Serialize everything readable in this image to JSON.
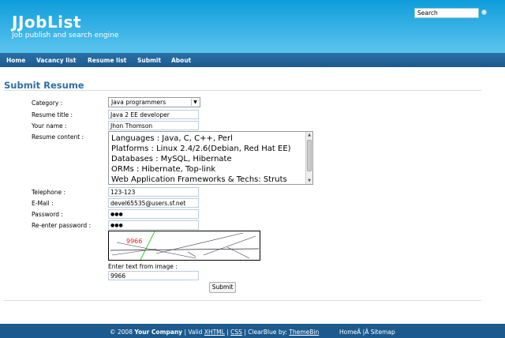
{
  "header": {
    "title": "JJobList",
    "subtitle": "Job publish and search engine",
    "search_value": "Search"
  },
  "nav": [
    "Home",
    "Vacancy list",
    "Resume list",
    "Submit",
    "About"
  ],
  "page_title": "Submit Resume",
  "form": {
    "category_label": "Category :",
    "category_value": "Java programmers",
    "resume_title_label": "Resume title :",
    "resume_title_value": "Java 2 EE developer",
    "name_label": "Your name :",
    "name_value": "Jhon Thomson",
    "content_label": "Resume content :",
    "content_lines": [
      "Languages : Java, C, C++, Perl",
      "Platforms : Linux 2.4/2.6(Debian, Red Hat EE)",
      "Databases : MySQL, Hibernate",
      "ORMs : Hibernate, Top-link",
      "Web Application Frameworks & Techs: Struts"
    ],
    "telephone_label": "Telephone :",
    "telephone_value": "123-123",
    "email_label": "E-Mail :",
    "email_value": "devel65535@users.sf.net",
    "password_label": "Password :",
    "password_value": "●●●",
    "repassword_label": "Re-enter password :",
    "repassword_value": "●●●",
    "captcha_text": "9966",
    "captcha_prompt": "Enter text from image :",
    "captcha_value": "9966",
    "submit_label": "Submit"
  },
  "footer": {
    "copyright": "© 2008",
    "company": "Your Company",
    "valid": "| Valid",
    "xhtml": "XHTML",
    "sep": "|",
    "css": "CSS",
    "clearblue": "| ClearBlue by:",
    "themebin": "ThemeBin",
    "home": "HomeÂ",
    "sitemap": "|Â Sitemap"
  }
}
